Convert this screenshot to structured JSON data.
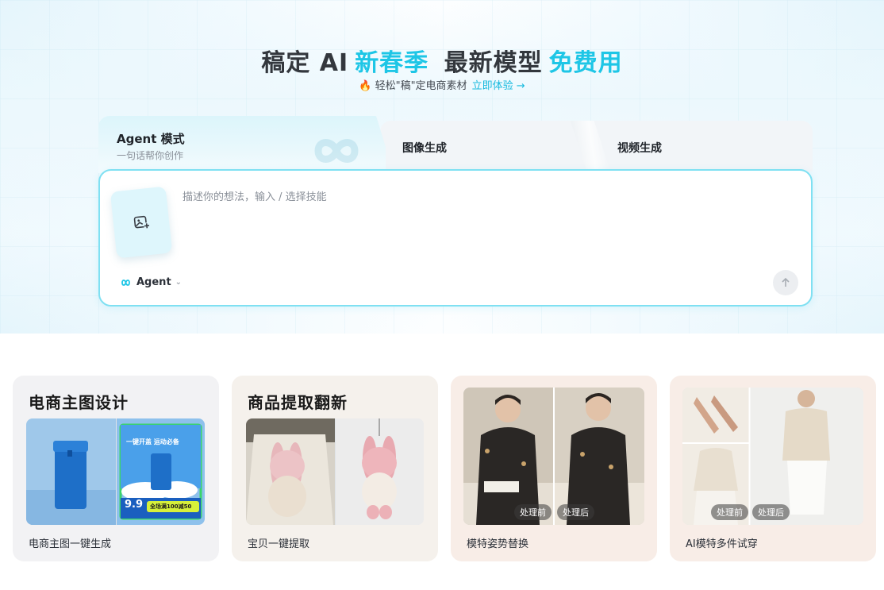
{
  "hero": {
    "title_prefix": "稿定 AI",
    "title_highlight1": "新春季",
    "title_middle": "最新模型",
    "title_highlight2": "免费用",
    "subtitle": "轻松\"稿\"定电商素材",
    "cta": "立即体验 →",
    "accent_color": "#1ec6e6"
  },
  "tabs": [
    {
      "label": "Agent 模式",
      "sub": "一句话帮你创作"
    },
    {
      "label": "图像生成"
    },
    {
      "label": "视频生成"
    }
  ],
  "prompt": {
    "placeholder": "描述你的想法，输入 / 选择技能",
    "agent_label": "Agent"
  },
  "cards": [
    {
      "title": "电商主图设计",
      "caption": "电商主图一键生成",
      "bg": "#f2f2f4",
      "promo_text": "一键开盖 运动必备",
      "price": "9.9",
      "promo_tag": "全场满100减50"
    },
    {
      "title": "商品提取翻新",
      "caption": "宝贝一键提取",
      "bg": "#f5f1ec"
    },
    {
      "caption": "模特姿势替换",
      "bg": "#f8ede7",
      "before": "处理前",
      "after": "处理后"
    },
    {
      "caption": "AI模特多件试穿",
      "bg": "#f8ede7",
      "before": "处理前",
      "after": "处理后"
    }
  ]
}
